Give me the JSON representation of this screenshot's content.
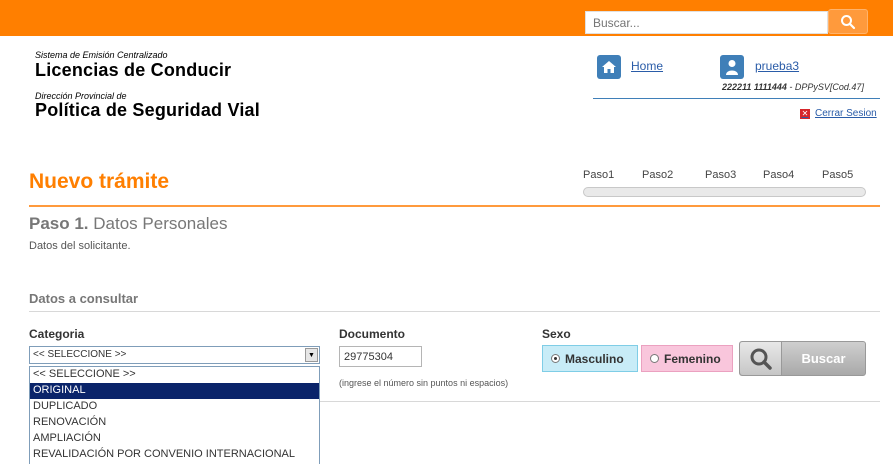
{
  "topbar": {
    "search_placeholder": "Buscar...",
    "search_button_icon": "search-icon",
    "color": "#ff7f00"
  },
  "brand": {
    "system_line": "Sistema de Emisión Centralizado",
    "product": "Licencias de Conducir",
    "dept_line": "Dirección Provincial de",
    "dept_name": "Política de Seguridad Vial"
  },
  "header_nav": {
    "home_label": "Home",
    "home_icon": "home-icon",
    "user_name": "prueba3",
    "user_icon": "user-icon",
    "user_id": "222211 1111444",
    "user_org": " - DPPySV[Cod.47]",
    "logout_label": "Cerrar Sesion",
    "logout_icon": "close-icon"
  },
  "page": {
    "title": "Nuevo trámite",
    "steps": [
      "Paso1",
      "Paso2",
      "Paso3",
      "Paso4",
      "Paso5"
    ],
    "step_heading_num": "Paso 1.",
    "step_heading_text": " Datos Personales",
    "step_sub": "Datos del solicitante."
  },
  "form": {
    "section_title": "Datos a consultar",
    "categoria": {
      "label": "Categoria",
      "selected": "<< SELECCIONE >>",
      "options": [
        "<< SELECCIONE >>",
        "ORIGINAL",
        "DUPLICADO",
        "RENOVACIÓN",
        "AMPLIACIÓN",
        "REVALIDACIÓN POR CONVENIO INTERNACIONAL"
      ],
      "highlighted_option": "ORIGINAL"
    },
    "documento": {
      "label": "Documento",
      "value": "29775304",
      "hint": "(ingrese el número sin puntos ni espacios)"
    },
    "sexo": {
      "label": "Sexo",
      "options": [
        "Masculino",
        "Femenino"
      ],
      "selected": "Masculino"
    },
    "buscar_label": "Buscar"
  }
}
